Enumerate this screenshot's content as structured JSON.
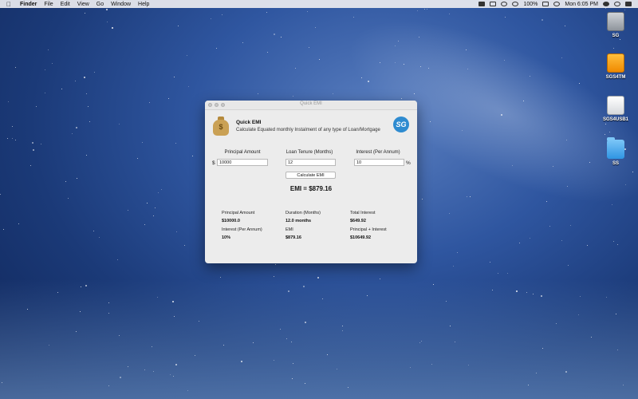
{
  "menubar": {
    "app_name": "Finder",
    "items": [
      "File",
      "Edit",
      "View",
      "Go",
      "Window",
      "Help"
    ],
    "battery": "100%",
    "clock": "Mon 6:05 PM"
  },
  "desktop": {
    "icons": [
      {
        "label": "SG",
        "icon": "hard-drive-icon"
      },
      {
        "label": "SGS4TM",
        "icon": "external-drive-icon"
      },
      {
        "label": "SGS4USB1",
        "icon": "usb-drive-icon"
      },
      {
        "label": "SS",
        "icon": "folder-icon"
      }
    ]
  },
  "window": {
    "title": "Quick EMI",
    "app_name": "Quick EMI",
    "description": "Calculate Equated monthly Instalment of any type of Loan/Mortgage",
    "logo_text": "SG",
    "inputs": {
      "principal": {
        "label": "Principal Amount",
        "prefix": "$",
        "value": "10000"
      },
      "tenure": {
        "label": "Loan Tenure (Months)",
        "value": "12"
      },
      "interest": {
        "label": "Interest (Per Annum)",
        "suffix": "%",
        "value": "10"
      }
    },
    "calculate_label": "Calculate EMI",
    "emi_result": "EMI = $879.16",
    "summary": {
      "principal_label": "Principal Amount",
      "principal_value": "$10000.0",
      "duration_label": "Duration (Months)",
      "duration_value": "12.0 months",
      "total_interest_label": "Total Interest",
      "total_interest_value": "$649.92",
      "interest_label": "Interest (Per Annum)",
      "interest_value": "10%",
      "emi_label": "EMI",
      "emi_value": "$879.16",
      "total_label": "Principal + Interest",
      "total_value": "$10649.92"
    }
  }
}
